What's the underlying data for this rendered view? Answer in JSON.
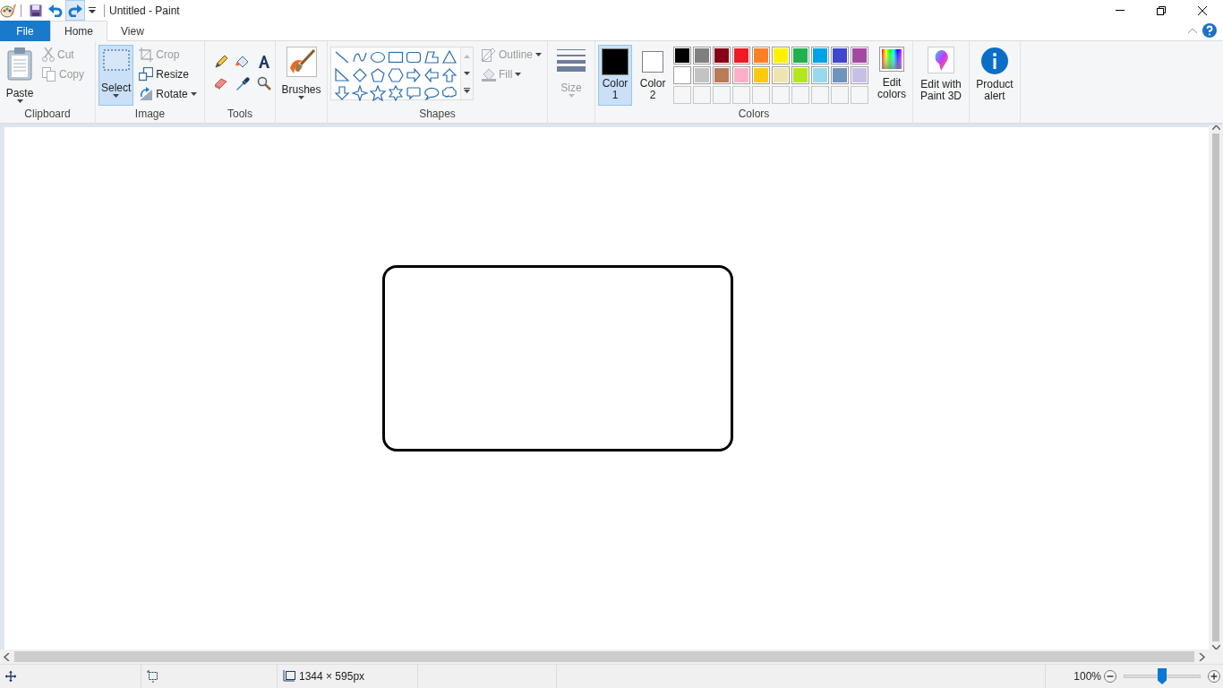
{
  "window": {
    "title": "Untitled - Paint"
  },
  "tabs": [
    {
      "label": "File",
      "kind": "file",
      "selected": false
    },
    {
      "label": "Home",
      "kind": "tab",
      "selected": true
    },
    {
      "label": "View",
      "kind": "tab",
      "selected": false
    }
  ],
  "ribbon": {
    "clipboard": {
      "label": "Clipboard",
      "paste": "Paste",
      "cut": {
        "label": "Cut",
        "disabled": true
      },
      "copy": {
        "label": "Copy",
        "disabled": true
      }
    },
    "image": {
      "label": "Image",
      "select": {
        "label": "Select",
        "selected": true
      },
      "crop": {
        "label": "Crop",
        "disabled": true
      },
      "resize": {
        "label": "Resize",
        "disabled": false
      },
      "rotate": {
        "label": "Rotate",
        "disabled": false
      }
    },
    "tools": {
      "label": "Tools"
    },
    "brushes": {
      "label": "Brushes"
    },
    "shapes": {
      "label": "Shapes",
      "outline": {
        "label": "Outline",
        "disabled": true
      },
      "fill": {
        "label": "Fill",
        "disabled": true
      }
    },
    "size": {
      "label": "Size",
      "disabled": true
    },
    "colors": {
      "label": "Colors",
      "color1": {
        "label": "Color 1",
        "selected": true,
        "color": "#000000"
      },
      "color2": {
        "label": "Color 2",
        "selected": false,
        "color": "#ffffff"
      },
      "palette": [
        [
          {
            "color": "#000000"
          },
          {
            "color": "#7f7f7f"
          },
          {
            "color": "#880015"
          },
          {
            "color": "#ed1c24"
          },
          {
            "color": "#ff7f27"
          },
          {
            "color": "#fff200"
          },
          {
            "color": "#22b14c"
          },
          {
            "color": "#00a2e8"
          },
          {
            "color": "#3f48cc"
          },
          {
            "color": "#a349a4"
          }
        ],
        [
          {
            "color": "#ffffff"
          },
          {
            "color": "#c3c3c3"
          },
          {
            "color": "#b97a57"
          },
          {
            "color": "#ffaec9"
          },
          {
            "color": "#ffc90e"
          },
          {
            "color": "#efe4b0"
          },
          {
            "color": "#b5e61d"
          },
          {
            "color": "#99d9ea"
          },
          {
            "color": "#7092be"
          },
          {
            "color": "#c8bfe7"
          }
        ]
      ],
      "edit_colors": "Edit colors"
    },
    "paint3d": {
      "label": "Edit with Paint 3D"
    },
    "product_alert": {
      "label": "Product alert"
    }
  },
  "status_bar": {
    "canvas_size": "1344 × 595px",
    "zoom": "100%",
    "zoom_slider": {
      "level": 0.5
    }
  }
}
